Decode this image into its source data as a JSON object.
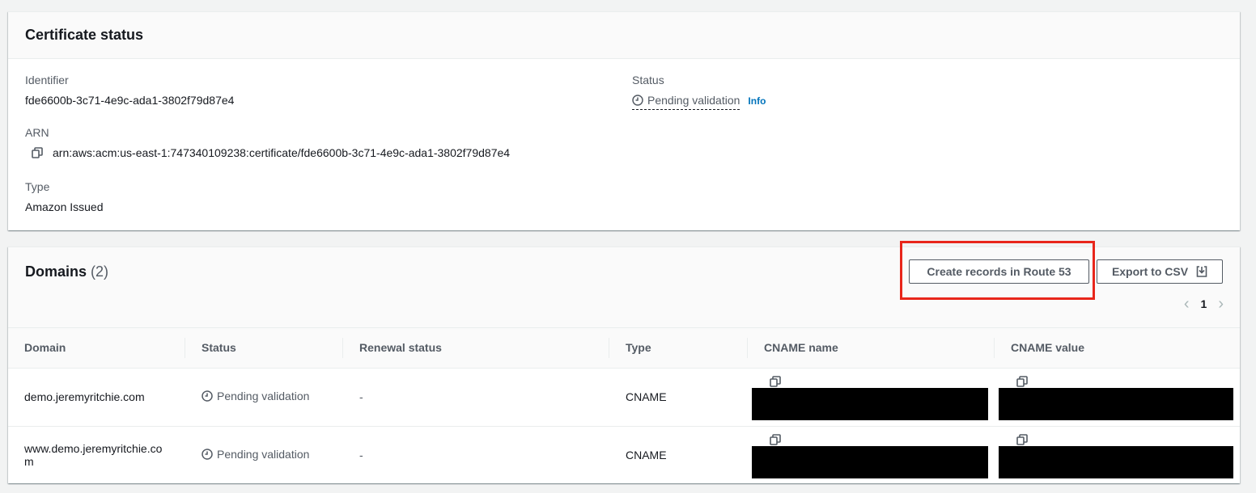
{
  "certificate_status": {
    "title": "Certificate status",
    "identifier": {
      "label": "Identifier",
      "value": "fde6600b-3c71-4e9c-ada1-3802f79d87e4"
    },
    "arn": {
      "label": "ARN",
      "value": "arn:aws:acm:us-east-1:747340109238:certificate/fde6600b-3c71-4e9c-ada1-3802f79d87e4"
    },
    "type": {
      "label": "Type",
      "value": "Amazon Issued"
    },
    "status": {
      "label": "Status",
      "value": "Pending validation",
      "info_link": "Info"
    }
  },
  "domains": {
    "title": "Domains",
    "count": "(2)",
    "buttons": {
      "create_records": "Create records in Route 53",
      "export_csv": "Export to CSV"
    },
    "pagination": {
      "prev": "‹",
      "current_page": "1",
      "next": "›"
    },
    "columns": [
      "Domain",
      "Status",
      "Renewal status",
      "Type",
      "CNAME name",
      "CNAME value"
    ],
    "rows": [
      {
        "domain": "demo.jeremyritchie.com",
        "status": "Pending validation",
        "renewal_status": "-",
        "type": "CNAME",
        "cname_name": "[redacted]",
        "cname_value": "[redacted]"
      },
      {
        "domain": "www.demo.jeremyritchie.com",
        "status": "Pending validation",
        "renewal_status": "-",
        "type": "CNAME",
        "cname_name": "[redacted]",
        "cname_value": "[redacted]"
      }
    ]
  },
  "colors": {
    "highlight": "#e8261b",
    "link": "#0073bb",
    "muted_text": "#545b64"
  }
}
